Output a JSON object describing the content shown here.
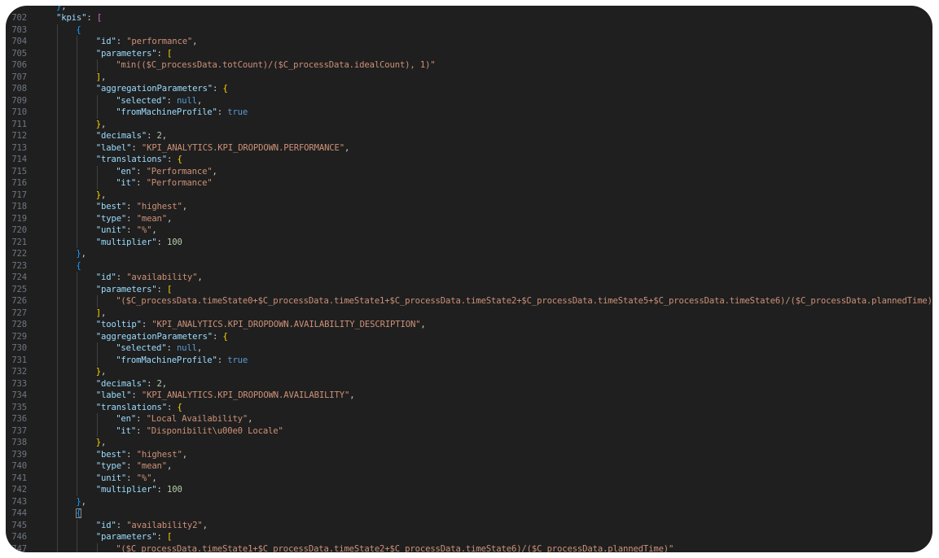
{
  "editor": {
    "lines": [
      {
        "n": "",
        "indent": 1,
        "tokens": [
          {
            "t": "}",
            "c": "b3"
          },
          {
            "t": ",",
            "c": "p"
          }
        ]
      },
      {
        "n": "702",
        "indent": 1,
        "tokens": [
          {
            "t": "\"kpis\"",
            "c": "key"
          },
          {
            "t": ": ",
            "c": "p"
          },
          {
            "t": "[",
            "c": "b2"
          }
        ]
      },
      {
        "n": "703",
        "indent": 2,
        "tokens": [
          {
            "t": "{",
            "c": "b3"
          }
        ]
      },
      {
        "n": "704",
        "indent": 3,
        "tokens": [
          {
            "t": "\"id\"",
            "c": "key"
          },
          {
            "t": ": ",
            "c": "p"
          },
          {
            "t": "\"performance\"",
            "c": "str"
          },
          {
            "t": ",",
            "c": "p"
          }
        ]
      },
      {
        "n": "705",
        "indent": 3,
        "tokens": [
          {
            "t": "\"parameters\"",
            "c": "key"
          },
          {
            "t": ": ",
            "c": "p"
          },
          {
            "t": "[",
            "c": "b1"
          }
        ]
      },
      {
        "n": "706",
        "indent": 4,
        "tokens": [
          {
            "t": "\"min(($C_processData.totCount)/($C_processData.idealCount), 1)\"",
            "c": "str"
          }
        ]
      },
      {
        "n": "707",
        "indent": 3,
        "tokens": [
          {
            "t": "]",
            "c": "b1"
          },
          {
            "t": ",",
            "c": "p"
          }
        ]
      },
      {
        "n": "708",
        "indent": 3,
        "tokens": [
          {
            "t": "\"aggregationParameters\"",
            "c": "key"
          },
          {
            "t": ": ",
            "c": "p"
          },
          {
            "t": "{",
            "c": "b1"
          }
        ]
      },
      {
        "n": "709",
        "indent": 4,
        "tokens": [
          {
            "t": "\"selected\"",
            "c": "key"
          },
          {
            "t": ": ",
            "c": "p"
          },
          {
            "t": "null",
            "c": "kw"
          },
          {
            "t": ",",
            "c": "p"
          }
        ]
      },
      {
        "n": "710",
        "indent": 4,
        "tokens": [
          {
            "t": "\"fromMachineProfile\"",
            "c": "key"
          },
          {
            "t": ": ",
            "c": "p"
          },
          {
            "t": "true",
            "c": "kw"
          }
        ]
      },
      {
        "n": "711",
        "indent": 3,
        "tokens": [
          {
            "t": "}",
            "c": "b1"
          },
          {
            "t": ",",
            "c": "p"
          }
        ]
      },
      {
        "n": "712",
        "indent": 3,
        "tokens": [
          {
            "t": "\"decimals\"",
            "c": "key"
          },
          {
            "t": ": ",
            "c": "p"
          },
          {
            "t": "2",
            "c": "num"
          },
          {
            "t": ",",
            "c": "p"
          }
        ]
      },
      {
        "n": "713",
        "indent": 3,
        "tokens": [
          {
            "t": "\"label\"",
            "c": "key"
          },
          {
            "t": ": ",
            "c": "p"
          },
          {
            "t": "\"KPI_ANALYTICS.KPI_DROPDOWN.PERFORMANCE\"",
            "c": "str"
          },
          {
            "t": ",",
            "c": "p"
          }
        ]
      },
      {
        "n": "714",
        "indent": 3,
        "tokens": [
          {
            "t": "\"translations\"",
            "c": "key"
          },
          {
            "t": ": ",
            "c": "p"
          },
          {
            "t": "{",
            "c": "b1"
          }
        ]
      },
      {
        "n": "715",
        "indent": 4,
        "tokens": [
          {
            "t": "\"en\"",
            "c": "key"
          },
          {
            "t": ": ",
            "c": "p"
          },
          {
            "t": "\"Performance\"",
            "c": "str"
          },
          {
            "t": ",",
            "c": "p"
          }
        ]
      },
      {
        "n": "716",
        "indent": 4,
        "tokens": [
          {
            "t": "\"it\"",
            "c": "key"
          },
          {
            "t": ": ",
            "c": "p"
          },
          {
            "t": "\"Performance\"",
            "c": "str"
          }
        ]
      },
      {
        "n": "717",
        "indent": 3,
        "tokens": [
          {
            "t": "}",
            "c": "b1"
          },
          {
            "t": ",",
            "c": "p"
          }
        ]
      },
      {
        "n": "718",
        "indent": 3,
        "tokens": [
          {
            "t": "\"best\"",
            "c": "key"
          },
          {
            "t": ": ",
            "c": "p"
          },
          {
            "t": "\"highest\"",
            "c": "str"
          },
          {
            "t": ",",
            "c": "p"
          }
        ]
      },
      {
        "n": "719",
        "indent": 3,
        "tokens": [
          {
            "t": "\"type\"",
            "c": "key"
          },
          {
            "t": ": ",
            "c": "p"
          },
          {
            "t": "\"mean\"",
            "c": "str"
          },
          {
            "t": ",",
            "c": "p"
          }
        ]
      },
      {
        "n": "720",
        "indent": 3,
        "tokens": [
          {
            "t": "\"unit\"",
            "c": "key"
          },
          {
            "t": ": ",
            "c": "p"
          },
          {
            "t": "\"%\"",
            "c": "str"
          },
          {
            "t": ",",
            "c": "p"
          }
        ]
      },
      {
        "n": "721",
        "indent": 3,
        "tokens": [
          {
            "t": "\"multiplier\"",
            "c": "key"
          },
          {
            "t": ": ",
            "c": "p"
          },
          {
            "t": "100",
            "c": "num"
          }
        ]
      },
      {
        "n": "722",
        "indent": 2,
        "tokens": [
          {
            "t": "}",
            "c": "b3"
          },
          {
            "t": ",",
            "c": "p"
          }
        ]
      },
      {
        "n": "723",
        "indent": 2,
        "tokens": [
          {
            "t": "{",
            "c": "b3"
          }
        ]
      },
      {
        "n": "724",
        "indent": 3,
        "tokens": [
          {
            "t": "\"id\"",
            "c": "key"
          },
          {
            "t": ": ",
            "c": "p"
          },
          {
            "t": "\"availability\"",
            "c": "str"
          },
          {
            "t": ",",
            "c": "p"
          }
        ]
      },
      {
        "n": "725",
        "indent": 3,
        "tokens": [
          {
            "t": "\"parameters\"",
            "c": "key"
          },
          {
            "t": ": ",
            "c": "p"
          },
          {
            "t": "[",
            "c": "b1"
          }
        ]
      },
      {
        "n": "726",
        "indent": 4,
        "tokens": [
          {
            "t": "\"($C_processData.timeState0+$C_processData.timeState1+$C_processData.timeState2+$C_processData.timeState5+$C_processData.timeState6)/($C_processData.plannedTime)\"",
            "c": "str"
          }
        ]
      },
      {
        "n": "727",
        "indent": 3,
        "tokens": [
          {
            "t": "]",
            "c": "b1"
          },
          {
            "t": ",",
            "c": "p"
          }
        ]
      },
      {
        "n": "728",
        "indent": 3,
        "tokens": [
          {
            "t": "\"tooltip\"",
            "c": "key"
          },
          {
            "t": ": ",
            "c": "p"
          },
          {
            "t": "\"KPI_ANALYTICS.KPI_DROPDOWN.AVAILABILITY_DESCRIPTION\"",
            "c": "str"
          },
          {
            "t": ",",
            "c": "p"
          }
        ]
      },
      {
        "n": "729",
        "indent": 3,
        "tokens": [
          {
            "t": "\"aggregationParameters\"",
            "c": "key"
          },
          {
            "t": ": ",
            "c": "p"
          },
          {
            "t": "{",
            "c": "b1"
          }
        ]
      },
      {
        "n": "730",
        "indent": 4,
        "tokens": [
          {
            "t": "\"selected\"",
            "c": "key"
          },
          {
            "t": ": ",
            "c": "p"
          },
          {
            "t": "null",
            "c": "kw"
          },
          {
            "t": ",",
            "c": "p"
          }
        ]
      },
      {
        "n": "731",
        "indent": 4,
        "tokens": [
          {
            "t": "\"fromMachineProfile\"",
            "c": "key"
          },
          {
            "t": ": ",
            "c": "p"
          },
          {
            "t": "true",
            "c": "kw"
          }
        ]
      },
      {
        "n": "732",
        "indent": 3,
        "tokens": [
          {
            "t": "}",
            "c": "b1"
          },
          {
            "t": ",",
            "c": "p"
          }
        ]
      },
      {
        "n": "733",
        "indent": 3,
        "tokens": [
          {
            "t": "\"decimals\"",
            "c": "key"
          },
          {
            "t": ": ",
            "c": "p"
          },
          {
            "t": "2",
            "c": "num"
          },
          {
            "t": ",",
            "c": "p"
          }
        ]
      },
      {
        "n": "734",
        "indent": 3,
        "tokens": [
          {
            "t": "\"label\"",
            "c": "key"
          },
          {
            "t": ": ",
            "c": "p"
          },
          {
            "t": "\"KPI_ANALYTICS.KPI_DROPDOWN.AVAILABILITY\"",
            "c": "str"
          },
          {
            "t": ",",
            "c": "p"
          }
        ]
      },
      {
        "n": "735",
        "indent": 3,
        "tokens": [
          {
            "t": "\"translations\"",
            "c": "key"
          },
          {
            "t": ": ",
            "c": "p"
          },
          {
            "t": "{",
            "c": "b1"
          }
        ]
      },
      {
        "n": "736",
        "indent": 4,
        "tokens": [
          {
            "t": "\"en\"",
            "c": "key"
          },
          {
            "t": ": ",
            "c": "p"
          },
          {
            "t": "\"Local Availability\"",
            "c": "str"
          },
          {
            "t": ",",
            "c": "p"
          }
        ]
      },
      {
        "n": "737",
        "indent": 4,
        "tokens": [
          {
            "t": "\"it\"",
            "c": "key"
          },
          {
            "t": ": ",
            "c": "p"
          },
          {
            "t": "\"Disponibilit\\u00e0 Locale\"",
            "c": "str"
          }
        ]
      },
      {
        "n": "738",
        "indent": 3,
        "tokens": [
          {
            "t": "}",
            "c": "b1"
          },
          {
            "t": ",",
            "c": "p"
          }
        ]
      },
      {
        "n": "739",
        "indent": 3,
        "tokens": [
          {
            "t": "\"best\"",
            "c": "key"
          },
          {
            "t": ": ",
            "c": "p"
          },
          {
            "t": "\"highest\"",
            "c": "str"
          },
          {
            "t": ",",
            "c": "p"
          }
        ]
      },
      {
        "n": "740",
        "indent": 3,
        "tokens": [
          {
            "t": "\"type\"",
            "c": "key"
          },
          {
            "t": ": ",
            "c": "p"
          },
          {
            "t": "\"mean\"",
            "c": "str"
          },
          {
            "t": ",",
            "c": "p"
          }
        ]
      },
      {
        "n": "741",
        "indent": 3,
        "tokens": [
          {
            "t": "\"unit\"",
            "c": "key"
          },
          {
            "t": ": ",
            "c": "p"
          },
          {
            "t": "\"%\"",
            "c": "str"
          },
          {
            "t": ",",
            "c": "p"
          }
        ]
      },
      {
        "n": "742",
        "indent": 3,
        "tokens": [
          {
            "t": "\"multiplier\"",
            "c": "key"
          },
          {
            "t": ": ",
            "c": "p"
          },
          {
            "t": "100",
            "c": "num"
          }
        ]
      },
      {
        "n": "743",
        "indent": 2,
        "tokens": [
          {
            "t": "}",
            "c": "b3"
          },
          {
            "t": ",",
            "c": "p"
          }
        ]
      },
      {
        "n": "744",
        "indent": 2,
        "tokens": [
          {
            "t": "{",
            "c": "b3",
            "sel": true
          }
        ]
      },
      {
        "n": "745",
        "indent": 3,
        "tokens": [
          {
            "t": "\"id\"",
            "c": "key"
          },
          {
            "t": ": ",
            "c": "p"
          },
          {
            "t": "\"availability2\"",
            "c": "str"
          },
          {
            "t": ",",
            "c": "p"
          }
        ]
      },
      {
        "n": "746",
        "indent": 3,
        "tokens": [
          {
            "t": "\"parameters\"",
            "c": "key"
          },
          {
            "t": ": ",
            "c": "p"
          },
          {
            "t": "[",
            "c": "b1"
          }
        ]
      },
      {
        "n": "747",
        "indent": 4,
        "tokens": [
          {
            "t": "\"($C_processData.timeState1+$C_processData.timeState2+$C_processData.timeState6)/($C_processData.plannedTime)\"",
            "c": "str"
          }
        ]
      }
    ]
  }
}
